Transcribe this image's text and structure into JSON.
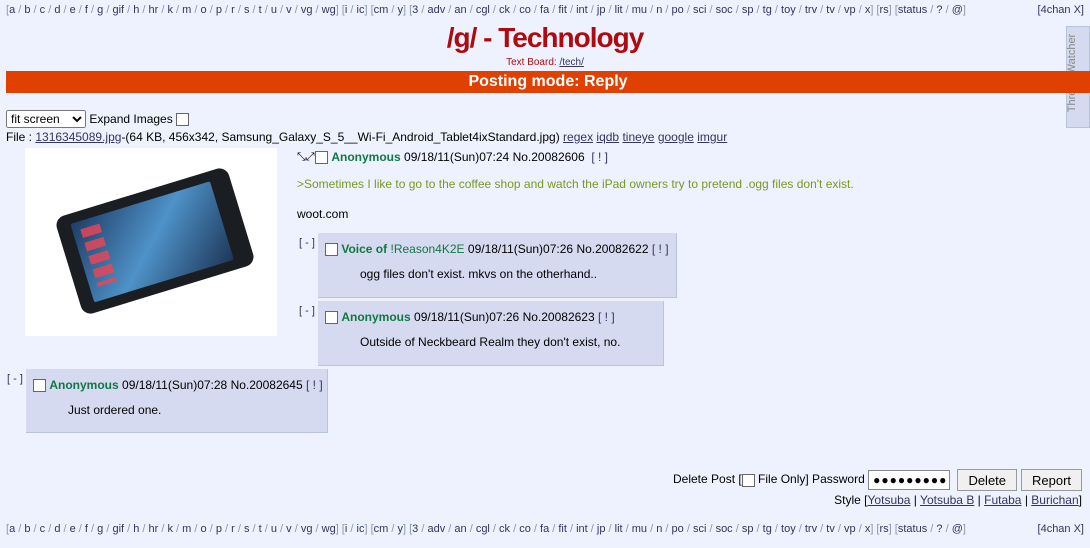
{
  "boardnav": {
    "groups": [
      [
        "a",
        "b",
        "c",
        "d",
        "e",
        "f",
        "g",
        "gif",
        "h",
        "hr",
        "k",
        "m",
        "o",
        "p",
        "r",
        "s",
        "t",
        "u",
        "v",
        "vg",
        "wg"
      ],
      [
        "i",
        "ic"
      ],
      [
        "cm",
        "y"
      ],
      [
        "3",
        "adv",
        "an",
        "cgl",
        "ck",
        "co",
        "fa",
        "fit",
        "int",
        "jp",
        "lit",
        "mu",
        "n",
        "po",
        "sci",
        "soc",
        "sp",
        "tg",
        "toy",
        "trv",
        "tv",
        "vp",
        "x"
      ],
      [
        "rs"
      ],
      [
        "status",
        "?",
        "@"
      ]
    ],
    "right": "[4chan X]"
  },
  "board": {
    "title": "/g/ - Technology",
    "text_board_label": "Text Board: ",
    "text_board_link": "/tech/"
  },
  "posting_mode": "Posting mode: Reply",
  "thread_watcher_label": "Thread Watcher",
  "controls": {
    "fit_option": "fit screen",
    "expand_images_label": "Expand Images"
  },
  "file": {
    "label": "File : ",
    "link": "1316345089.jpg",
    "meta": "-(64 KB, 456x342, Samsung_Galaxy_S_5__Wi-Fi_Android_Tablet4ixStandard.jpg)",
    "tools": [
      "regex",
      "iqdb",
      "tineye",
      "google",
      "imgur"
    ]
  },
  "op": {
    "name": "Anonymous",
    "datetime": "09/18/11(Sun)07:24",
    "number": "No.20082606",
    "report": "[ ! ]",
    "quote": ">Sometimes I like to go to the coffee shop and watch the iPad owners try to pretend .ogg files don't exist.",
    "text": "woot.com"
  },
  "replies": [
    {
      "name": "Voice of",
      "trip": "!Reason4K2E",
      "datetime": "09/18/11(Sun)07:26",
      "number": "No.20082622",
      "report": "[ ! ]",
      "text": "ogg files don't exist. mkvs on the otherhand..",
      "collapse": "[ - ]"
    },
    {
      "name": "Anonymous",
      "trip": "",
      "datetime": "09/18/11(Sun)07:26",
      "number": "No.20082623",
      "report": "[ ! ]",
      "text": "Outside of Neckbeard Realm they don't exist, no.",
      "collapse": "[ - ]"
    },
    {
      "name": "Anonymous",
      "trip": "",
      "datetime": "09/18/11(Sun)07:28",
      "number": "No.20082645",
      "report": "[ ! ]",
      "text": "Just ordered one.",
      "collapse": "[ - ]"
    }
  ],
  "delete": {
    "delete_post": "Delete Post [",
    "file_only": "File Only] Password",
    "password_mask": "●●●●●●●●●",
    "delete_button": "Delete",
    "report_button": "Report"
  },
  "styles": {
    "label": "Style [",
    "options": [
      "Yotsuba",
      "Yotsuba B",
      "Futaba",
      "Burichan"
    ],
    "close": "]"
  },
  "colors": {
    "accent": "#e04000",
    "title": "#af0a0f",
    "name": "#117743",
    "quote": "#789922",
    "reply_bg": "#d6daf0"
  }
}
